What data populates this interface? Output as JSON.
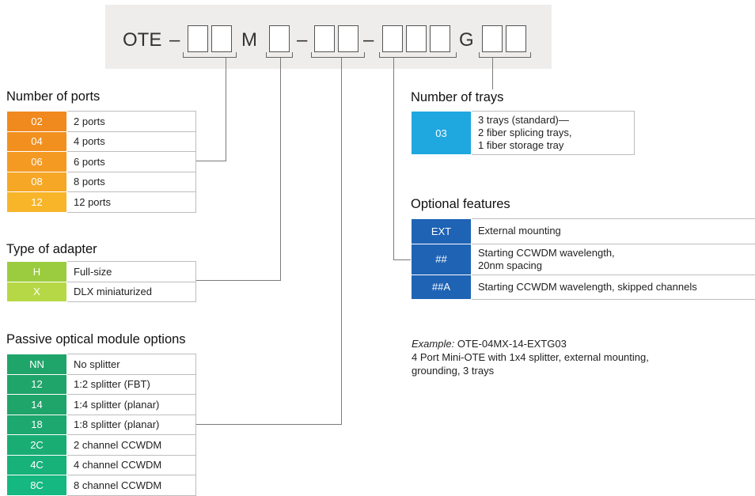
{
  "part_number": {
    "prefix": "OTE",
    "dash": "–",
    "m": "M",
    "g": "G"
  },
  "sections": {
    "ports": {
      "title": "Number of ports",
      "rows": [
        {
          "code": "02",
          "desc": "2 ports"
        },
        {
          "code": "04",
          "desc": "4 ports"
        },
        {
          "code": "06",
          "desc": "6 ports"
        },
        {
          "code": "08",
          "desc": "8 ports"
        },
        {
          "code": "12",
          "desc": "12 ports"
        }
      ],
      "colors": [
        "#f08a1e",
        "#f2901f",
        "#f49a22",
        "#f6a726",
        "#f8b52a"
      ]
    },
    "adapter": {
      "title": "Type of adapter",
      "rows": [
        {
          "code": "H",
          "desc": "Full-size"
        },
        {
          "code": "X",
          "desc": "DLX miniaturized"
        }
      ],
      "colors": [
        "#9bcc3f",
        "#b7d846"
      ]
    },
    "module": {
      "title": "Passive optical module options",
      "rows": [
        {
          "code": "NN",
          "desc": "No splitter"
        },
        {
          "code": "12",
          "desc": "1:2 splitter (FBT)"
        },
        {
          "code": "14",
          "desc": "1:4 splitter (planar)"
        },
        {
          "code": "18",
          "desc": "1:8 splitter (planar)"
        },
        {
          "code": "2C",
          "desc": "2 channel CCWDM"
        },
        {
          "code": "4C",
          "desc": "4 channel CCWDM"
        },
        {
          "code": "8C",
          "desc": "8 channel CCWDM"
        }
      ],
      "colors": [
        "#1fa46a",
        "#1fa46a",
        "#1fa46a",
        "#1ca86e",
        "#19ad74",
        "#17b27a",
        "#15b880"
      ]
    },
    "trays": {
      "title": "Number of trays",
      "rows": [
        {
          "code": "03",
          "desc_lines": [
            "3 trays (standard)—",
            "2 fiber splicing trays,",
            "1 fiber storage tray"
          ]
        }
      ],
      "colors": [
        "#1fa7e0"
      ]
    },
    "features": {
      "title": "Optional features",
      "rows": [
        {
          "code": "EXT",
          "desc_lines": [
            "External mounting"
          ]
        },
        {
          "code": "##",
          "desc_lines": [
            "Starting CCWDM wavelength,",
            "20nm spacing"
          ]
        },
        {
          "code": "##A",
          "desc_lines": [
            "Starting CCWDM wavelength, skipped channels"
          ]
        }
      ],
      "colors": [
        "#1f63b4",
        "#1f63b4",
        "#1f63b4"
      ]
    }
  },
  "example": {
    "label": "Example:",
    "code": " OTE-04MX-14-EXTG03",
    "line2": "4 Port Mini-OTE with 1x4 splitter, external mounting,",
    "line3": "grounding, 3 trays"
  }
}
